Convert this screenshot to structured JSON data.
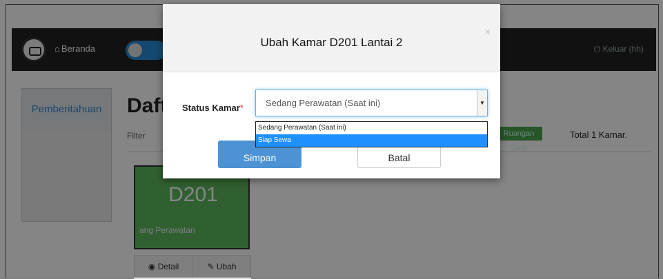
{
  "navbar": {
    "home_label": "Beranda",
    "logout_label": "Keluar (hh)"
  },
  "sidebar": {
    "tab_label": "Pemberitahuan"
  },
  "main": {
    "title": "Daft",
    "filter_label": "Filter",
    "badge_label": "Ruangan Data",
    "total_label": "Total 1 Kamar."
  },
  "room_card": {
    "name": "D201",
    "status": "ang Perawatan",
    "detail_label": "Detail",
    "edit_label": "Ubah"
  },
  "modal": {
    "title": "Ubah Kamar D201 Lantai 2",
    "close_glyph": "×",
    "field_label": "Status Kamar",
    "required_mark": "*",
    "select_value": "Sedang Perawatan (Saat ini)",
    "options": [
      {
        "label": "Sedang Perawatan (Saat ini)"
      },
      {
        "label": "Siap Sewa"
      }
    ],
    "save_label": "Simpan",
    "cancel_label": "Batal"
  },
  "colors": {
    "navbar": "#222222",
    "primary": "#4c92d4",
    "room_card": "#5cb85c",
    "dropdown_highlight": "#1e90ff"
  }
}
